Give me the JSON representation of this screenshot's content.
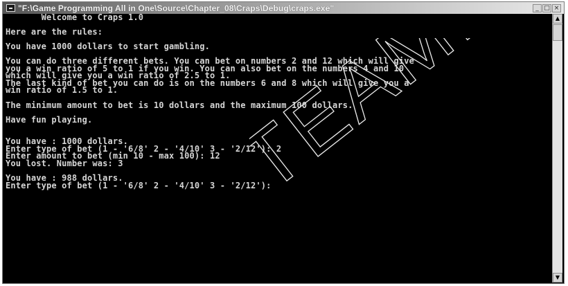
{
  "window": {
    "title": "\"F:\\Game Programming All in One\\Source\\Chapter_08\\Craps\\Debug\\craps.exe\"",
    "icon": "console-app-icon",
    "buttons": {
      "minimize": "_",
      "maximize": "□",
      "close": "×"
    }
  },
  "console": {
    "lines": [
      "       Welcome to Craps 1.0",
      "",
      "Here are the rules:",
      "",
      "You have 1000 dollars to start gambling.",
      "",
      "You can do three different bets. You can bet on numbers 2 and 12 which will give",
      "you a win ratio of 5 to 1 if you win. You can also bet on the numbers 4 and 10",
      "which will give you a win ratio of 2.5 to 1.",
      "The last kind of bet you can do is on the numbers 6 and 8 which will give you a",
      "win ratio of 1.5 to 1.",
      "",
      "The minimum amount to bet is 10 dollars and the maximum 100 dollars.",
      "",
      "Have fun playing.",
      "",
      "",
      "You have : 1000 dollars.",
      "Enter type of bet (1 - '6/8' 2 - '4/10' 3 - '2/12'): 2",
      "Enter amount to bet (min 10 - max 100): 12",
      "You lost. Number was: 3",
      "",
      "You have : 988 dollars.",
      "Enter type of bet (1 - '6/8' 2 - '4/10' 3 - '2/12'):"
    ]
  },
  "scrollbar": {
    "up_arrow": "▲",
    "down_arrow": "▼"
  },
  "watermark": {
    "text": "TEAMFLY"
  },
  "colors": {
    "console_bg": "#000000",
    "console_text": "#d6d6d6"
  }
}
